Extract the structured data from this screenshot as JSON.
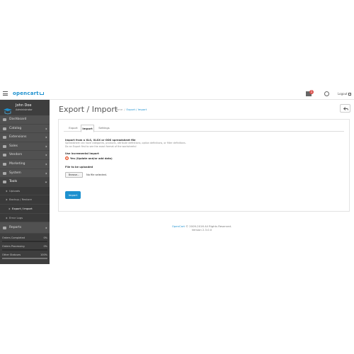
{
  "header": {
    "logo_text": "opencart",
    "alert_count": "1",
    "logout_label": "Logout"
  },
  "profile": {
    "name": "John Doe",
    "role": "Administrator"
  },
  "sidebar": {
    "items": [
      {
        "label": "Dashboard",
        "icon": "dashboard-icon"
      },
      {
        "label": "Catalog",
        "icon": "tag-icon"
      },
      {
        "label": "Extensions",
        "icon": "puzzle-icon"
      },
      {
        "label": "Sales",
        "icon": "cart-icon"
      },
      {
        "label": "Vendors",
        "icon": "users-icon"
      },
      {
        "label": "Marketing",
        "icon": "share-icon"
      },
      {
        "label": "System",
        "icon": "cog-icon"
      },
      {
        "label": "Tools",
        "icon": "wrench-icon"
      }
    ],
    "tools_sub": [
      {
        "label": "Uploads"
      },
      {
        "label": "Backup / Restore"
      },
      {
        "label": "Export / Import"
      },
      {
        "label": "Error Logs"
      }
    ],
    "reports": {
      "label": "Reports",
      "icon": "bar-chart-icon"
    },
    "stats": [
      {
        "label": "Orders Completed",
        "value": "0%",
        "fraction": 0.0
      },
      {
        "label": "Orders Processing",
        "value": "0%",
        "fraction": 0.0
      },
      {
        "label": "Other Statuses",
        "value": "100%",
        "fraction": 1.0
      }
    ]
  },
  "page": {
    "title": "Export / Import",
    "breadcrumb_home": "Home",
    "breadcrumb_current": "Export / Import"
  },
  "tabs": [
    {
      "label": "Export"
    },
    {
      "label": "Import"
    },
    {
      "label": "Settings"
    }
  ],
  "import": {
    "heading": "Import from a XLS, XLSX or ODS spreadsheet file",
    "help1": "Spreadsheet can have categories, products, attribute definitions, option definitions, or filter definitions.",
    "help2": "Do an Export first to see the exact format of the worksheets!",
    "incremental_label": "Use incremental Import",
    "radio_label": "Yes (Update and/or add data)",
    "file_label": "File to be uploaded",
    "browse_label": "Browse...",
    "no_file": "No file selected.",
    "import_button": "Import"
  },
  "footer": {
    "brand": "OpenCart",
    "copyright": "© 2009-2016 All Rights Reserved.",
    "version": "Version 2.3.0.0"
  },
  "colors": {
    "accent": "#1e91cf",
    "sidebar_bg": "#515151",
    "radio_checked": "#e8491d"
  }
}
